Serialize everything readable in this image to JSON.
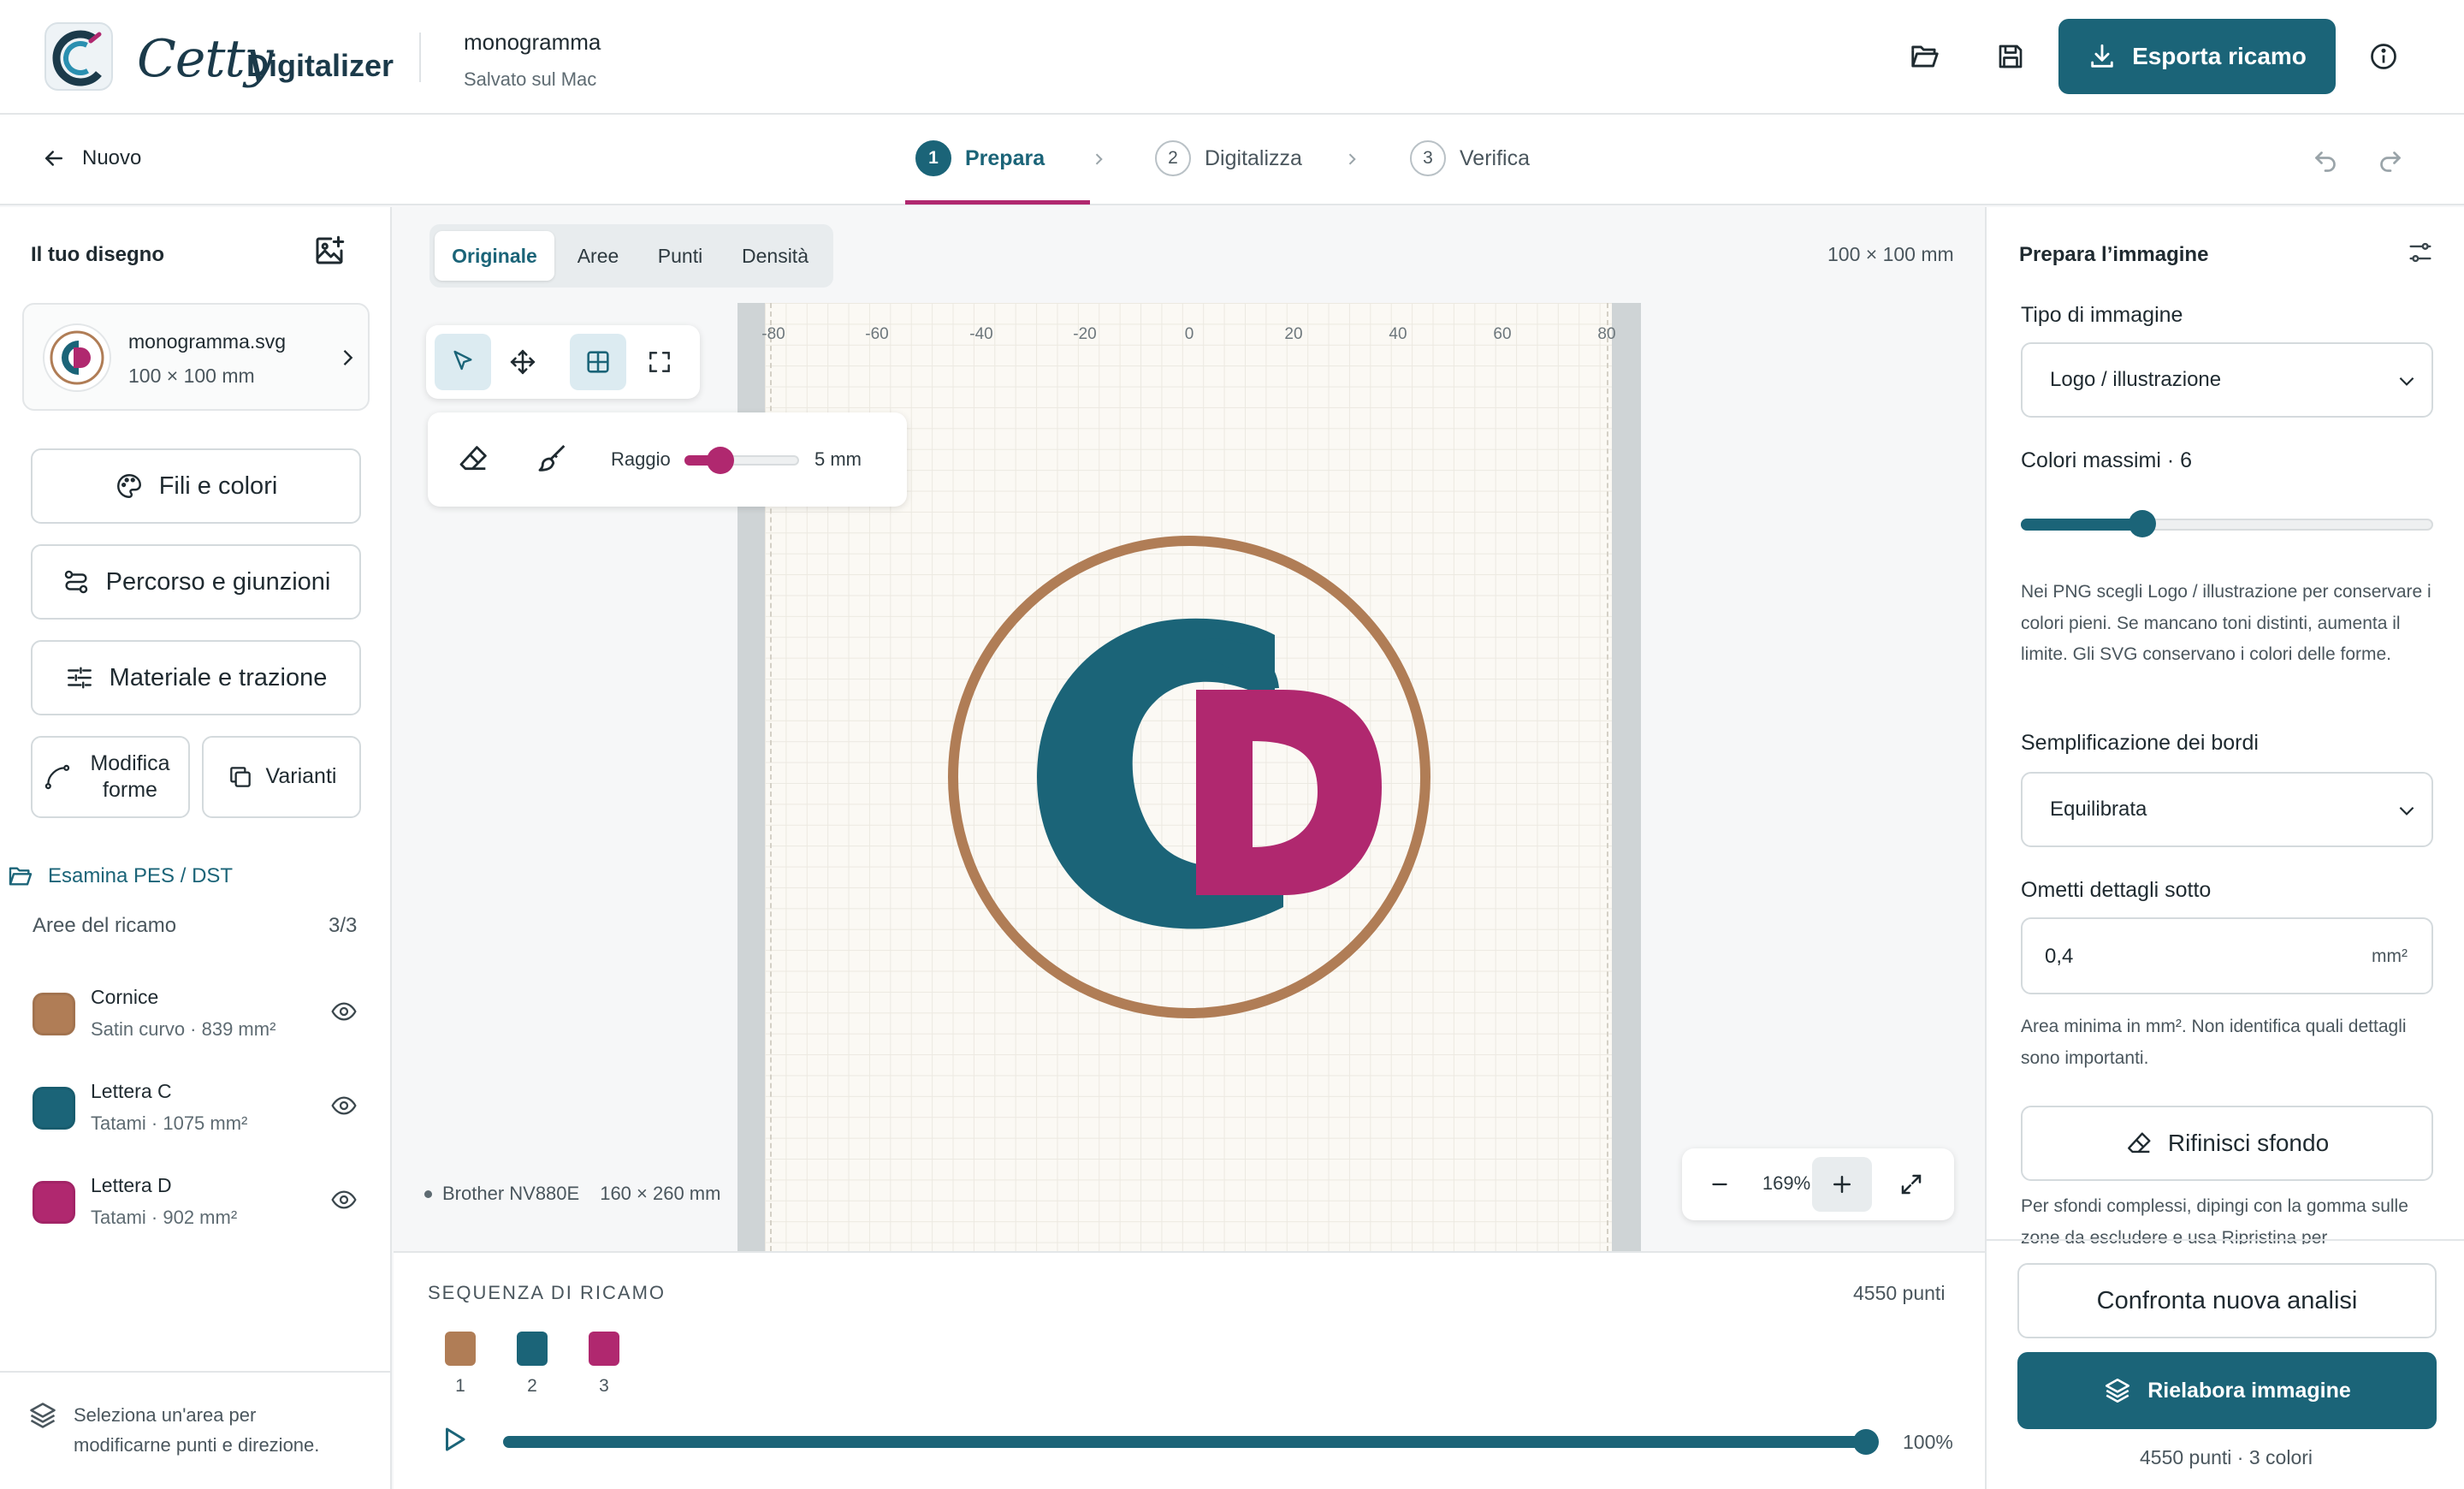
{
  "app": {
    "brand": "Cetty",
    "brand_sub": "Digitalizer",
    "doc_title": "monogramma",
    "doc_status": "Salvato sul Mac",
    "export_label": "Esporta ricamo"
  },
  "steps": {
    "back_label": "Nuovo",
    "items": [
      {
        "num": "1",
        "label": "Prepara"
      },
      {
        "num": "2",
        "label": "Digitalizza"
      },
      {
        "num": "3",
        "label": "Verifica"
      }
    ]
  },
  "left": {
    "heading": "Il tuo disegno",
    "file": {
      "name": "monogramma.svg",
      "size": "100 × 100 mm"
    },
    "buttons": {
      "threads": "Fili e colori",
      "path": "Percorso e giunzioni",
      "material": "Materiale e trazione",
      "edit_shapes": "Modifica forme",
      "variants": "Varianti"
    },
    "inspect_link": "Esamina PES / DST",
    "areas_label": "Aree del ricamo",
    "areas_count": "3/3",
    "areas": [
      {
        "name": "Cornice",
        "meta": "Satin curvo · 839 mm²",
        "color": "#b07d56"
      },
      {
        "name": "Lettera C",
        "meta": "Tatami · 1075 mm²",
        "color": "#1b6478"
      },
      {
        "name": "Lettera D",
        "meta": "Tatami · 902 mm²",
        "color": "#b0286f"
      }
    ],
    "hint": "Seleziona un'area per modificarne punti e direzione."
  },
  "center": {
    "tabs": [
      "Originale",
      "Aree",
      "Punti",
      "Densità"
    ],
    "dimensions": "100 × 100 mm",
    "ruler": [
      "-80",
      "-60",
      "-40",
      "-20",
      "0",
      "20",
      "40",
      "60",
      "80"
    ],
    "brush": {
      "label": "Raggio",
      "value": "5 mm",
      "level": 0.33
    },
    "machine": "Brother NV880E",
    "machine_hoop": "160 × 260 mm",
    "zoom": "169%"
  },
  "sequence": {
    "title": "SEQUENZA DI RICAMO",
    "points": "4550 punti",
    "swatches": [
      {
        "num": "1",
        "color": "#b07d56"
      },
      {
        "num": "2",
        "color": "#1b6478"
      },
      {
        "num": "3",
        "color": "#b0286f"
      }
    ],
    "progress": "100%"
  },
  "right": {
    "title": "Prepara l’immagine",
    "type_label": "Tipo di immagine",
    "type_value": "Logo / illustrazione",
    "colors_label": "Colori massimi · 6",
    "colors_value": 6,
    "help_png": "Nei PNG scegli Logo / illustrazione per conservare i colori pieni. Se mancano toni distinti, aumenta il limite. Gli SVG conservano i colori delle forme.",
    "edges_label": "Semplificazione dei bordi",
    "edges_value": "Equilibrata",
    "omit_label": "Ometti dettagli sotto",
    "omit_value": "0,4",
    "omit_unit": "mm²",
    "help_omit": "Area minima in mm². Non identifica quali dettagli sono importanti.",
    "refine_label": "Rifinisci sfondo",
    "help_refine": "Per sfondi complessi, dipingi con la gomma sulle zone da escludere e usa Ripristina per",
    "compare_label": "Confronta nuova analisi",
    "rework_label": "Rielabora immagine",
    "summary": "4550 punti · 3 colori"
  },
  "colors": {
    "accent": "#1b6478",
    "magenta": "#b0286f",
    "frame": "#b07d56"
  }
}
